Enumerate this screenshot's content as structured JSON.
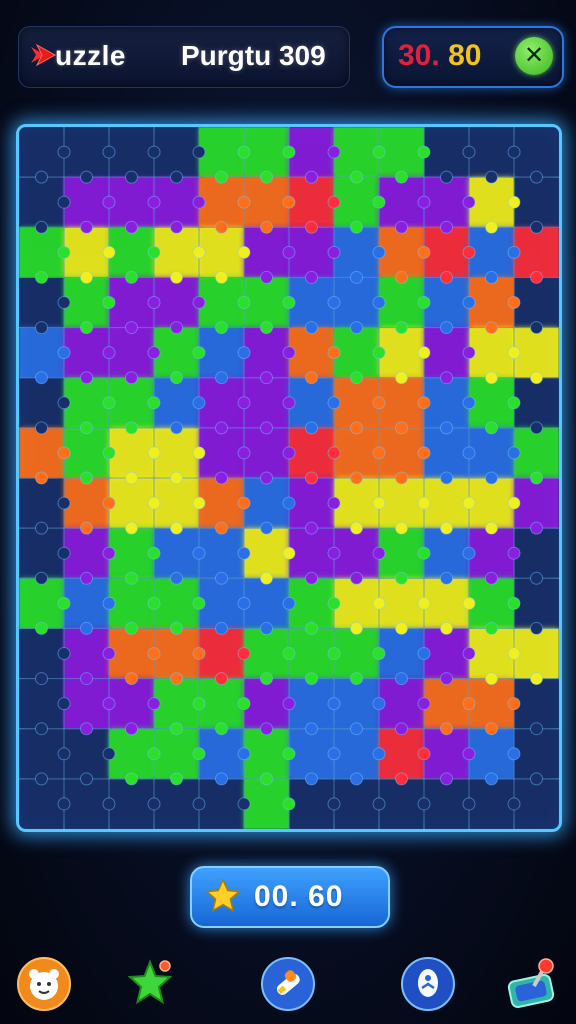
{
  "header": {
    "logo_text": "uzzle",
    "title": "Purgtu 309",
    "timer_red": "30.",
    "timer_yellow": "80"
  },
  "score": {
    "value": "00. 60"
  },
  "icons": {
    "logo": "red-arrow-icon",
    "close": "green-x-icon",
    "star": "star-icon",
    "tools": [
      "character-face-icon",
      "star-sparkle-icon",
      "rocket-icon",
      "hint-bulb-icon",
      "joystick-icon"
    ]
  },
  "colors": {
    "frame_glow": "#56c8ff",
    "piece_palette": {
      "G": "#2be02a",
      "P": "#8a1fe0",
      "Y": "#f2f01c",
      "O": "#ff6f1a",
      "R": "#ff2e3a",
      "B": "#2a6fe6",
      "D": "#17306b",
      "K": "#0f2352"
    }
  },
  "board": {
    "cols": 12,
    "rows": 14,
    "rows_data": [
      "DDDDGGPGGDDD",
      "DPPPOORGPPYD",
      "GYGYYPPBORBR",
      "DGPPGGBBGBOD",
      "BPPGBPOGYPYY",
      "DGGBPPBOOBGD",
      "OGYYPPROOBBG",
      "DOYYOBPYYYYP",
      "DPGBBYPPGBPD",
      "GBGGBBGYYYGD",
      "DPOORGGGBPYY",
      "DPPGGPBBPOOD",
      "DDGGBGBBRPBD",
      "DDDDDGDDDDDD"
    ]
  }
}
